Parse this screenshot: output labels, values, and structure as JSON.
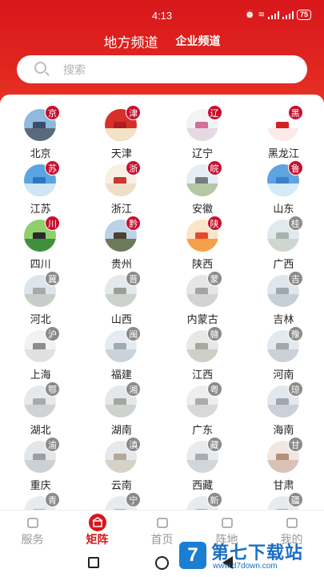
{
  "status_bar": {
    "time": "4:13",
    "battery": "75"
  },
  "header": {
    "tab_local": "地方频道",
    "tab_enterprise": "企业频道"
  },
  "search": {
    "placeholder": "搜索"
  },
  "provinces": [
    {
      "name": "北京",
      "badge": "京",
      "badge_color": "#c8102e",
      "sky": "#8fb9dd",
      "land": "#5b6a7a",
      "bld": "#3b4d6b"
    },
    {
      "name": "天津",
      "badge": "津",
      "badge_color": "#c8102e",
      "sky": "#d6302a",
      "land": "#f1e3c4",
      "bld": "#b21d1d"
    },
    {
      "name": "辽宁",
      "badge": "辽",
      "badge_color": "#c8102e",
      "sky": "#f3f3f3",
      "land": "#e6d9e3",
      "bld": "#d46f9a"
    },
    {
      "name": "黑龙江",
      "badge": "黑",
      "badge_color": "#c8102e",
      "sky": "#ffffff",
      "land": "#fbeaea",
      "bld": "#d42020"
    },
    {
      "name": "江苏",
      "badge": "苏",
      "badge_color": "#c8102e",
      "sky": "#5aa5e0",
      "land": "#cfe6f6",
      "bld": "#2a77c2"
    },
    {
      "name": "浙江",
      "badge": "浙",
      "badge_color": "#c8102e",
      "sky": "#f8f0e5",
      "land": "#f0dfc8",
      "bld": "#c33a2a"
    },
    {
      "name": "安徽",
      "badge": "皖",
      "badge_color": "#c8102e",
      "sky": "#e3eef7",
      "land": "#b5c8a2",
      "bld": "#7a7a7a"
    },
    {
      "name": "山东",
      "badge": "鲁",
      "badge_color": "#c8102e",
      "sky": "#5fa3e0",
      "land": "#d6eaf8",
      "bld": "#3783c9"
    },
    {
      "name": "四川",
      "badge": "川",
      "badge_color": "#c8102e",
      "sky": "#8fcf6e",
      "land": "#3f8f3f",
      "bld": "#2a2a2a"
    },
    {
      "name": "贵州",
      "badge": "黔",
      "badge_color": "#c8102e",
      "sky": "#bcd2e6",
      "land": "#6c7a5a",
      "bld": "#4a4032"
    },
    {
      "name": "陕西",
      "badge": "陕",
      "badge_color": "#c8102e",
      "sky": "#fbe4c8",
      "land": "#f5a04a",
      "bld": "#e24a2a"
    },
    {
      "name": "广西",
      "badge": "桂",
      "badge_color": "#8a8a8a",
      "sky": "#e1e8ee",
      "land": "#cfd6cf",
      "bld": "#a9b3ad"
    },
    {
      "name": "河北",
      "badge": "冀",
      "badge_color": "#8a8a8a",
      "sky": "#dde5ec",
      "land": "#c9cdc9",
      "bld": "#a6aba6"
    },
    {
      "name": "山西",
      "badge": "晋",
      "badge_color": "#8a8a8a",
      "sky": "#e4e9ee",
      "land": "#cdd2cd",
      "bld": "#9aa19a"
    },
    {
      "name": "内蒙古",
      "badge": "蒙",
      "badge_color": "#8a8a8a",
      "sky": "#e6e6e6",
      "land": "#d3d3d3",
      "bld": "#a4a4a4"
    },
    {
      "name": "吉林",
      "badge": "吉",
      "badge_color": "#8a8a8a",
      "sky": "#dfe6ec",
      "land": "#c7cfd6",
      "bld": "#9ea8b1"
    },
    {
      "name": "上海",
      "badge": "沪",
      "badge_color": "#8a8a8a",
      "sky": "#f2f2f2",
      "land": "#e0e0e0",
      "bld": "#8e8e8e"
    },
    {
      "name": "福建",
      "badge": "闽",
      "badge_color": "#8a8a8a",
      "sky": "#e5ebf0",
      "land": "#cad3d9",
      "bld": "#a1aab2"
    },
    {
      "name": "江西",
      "badge": "赣",
      "badge_color": "#8a8a8a",
      "sky": "#e8e8e6",
      "land": "#cfcfc8",
      "bld": "#a8a89e"
    },
    {
      "name": "河南",
      "badge": "豫",
      "badge_color": "#8a8a8a",
      "sky": "#e3e9ee",
      "land": "#cbd1d6",
      "bld": "#a0a7ad"
    },
    {
      "name": "湖北",
      "badge": "鄂",
      "badge_color": "#8a8a8a",
      "sky": "#e6e9ec",
      "land": "#d0d3d6",
      "bld": "#a7abaf"
    },
    {
      "name": "湖南",
      "badge": "湘",
      "badge_color": "#8a8a8a",
      "sky": "#e4e8ea",
      "land": "#cfd3cf",
      "bld": "#a3a7a3"
    },
    {
      "name": "广东",
      "badge": "粤",
      "badge_color": "#8a8a8a",
      "sky": "#eeeeee",
      "land": "#d8d8d8",
      "bld": "#ababab"
    },
    {
      "name": "海南",
      "badge": "琼",
      "badge_color": "#8a8a8a",
      "sky": "#e2e8ed",
      "land": "#c9d0d6",
      "bld": "#9fa7ae"
    },
    {
      "name": "重庆",
      "badge": "渝",
      "badge_color": "#8a8a8a",
      "sky": "#e3e7ea",
      "land": "#cdd1d4",
      "bld": "#9aa0a5"
    },
    {
      "name": "云南",
      "badge": "滇",
      "badge_color": "#8a8a8a",
      "sky": "#e6e9ea",
      "land": "#d6d2c8",
      "bld": "#b2aa98"
    },
    {
      "name": "西藏",
      "badge": "藏",
      "badge_color": "#8a8a8a",
      "sky": "#e8ebee",
      "land": "#d2d6da",
      "bld": "#a9aeb3"
    },
    {
      "name": "甘肃",
      "badge": "甘",
      "badge_color": "#8a8a8a",
      "sky": "#f1e7e2",
      "land": "#d9c2b6",
      "bld": "#b78e7a"
    },
    {
      "name": "",
      "badge": "青",
      "badge_color": "#8a8a8a",
      "sky": "#e8ebee",
      "land": "#d2d6da",
      "bld": "#a9aeb3"
    },
    {
      "name": "",
      "badge": "宁",
      "badge_color": "#8a8a8a",
      "sky": "#e8ebee",
      "land": "#d2d6da",
      "bld": "#a9aeb3"
    },
    {
      "name": "",
      "badge": "新",
      "badge_color": "#8a8a8a",
      "sky": "#e8ebee",
      "land": "#d2d6da",
      "bld": "#a9aeb3"
    },
    {
      "name": "",
      "badge": "疆",
      "badge_color": "#8a8a8a",
      "sky": "#e8ebee",
      "land": "#d2d6da",
      "bld": "#a9aeb3"
    }
  ],
  "bottom_nav": [
    {
      "label": "服务",
      "icon": "service-icon",
      "active": false
    },
    {
      "label": "矩阵",
      "icon": "matrix-icon",
      "active": true
    },
    {
      "label": "首页",
      "icon": "home-icon",
      "active": false
    },
    {
      "label": "阵地",
      "icon": "location-icon",
      "active": false
    },
    {
      "label": "我的",
      "icon": "profile-icon",
      "active": false
    }
  ],
  "watermark": {
    "logo": "7",
    "title": "第七下载站",
    "url": "www.d7down.com"
  },
  "colors": {
    "brand_red": "#d8171b",
    "inactive_gray": "#999999"
  }
}
